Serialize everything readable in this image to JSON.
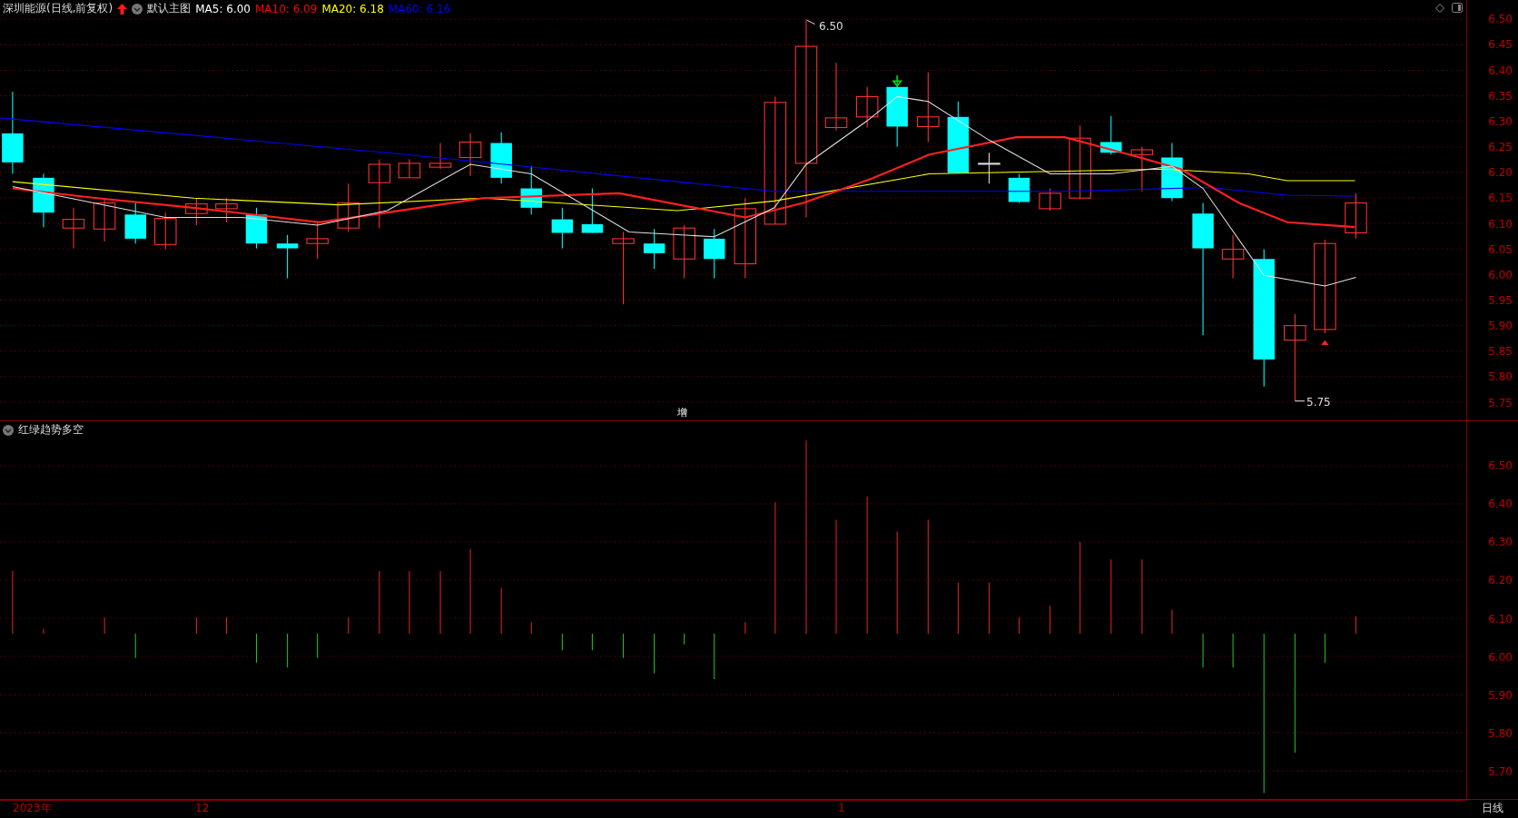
{
  "header": {
    "title": "深圳能源(日线,前复权)",
    "template": "默认主图",
    "moving_averages": [
      {
        "label": "MA5: 6.00",
        "color": "#ffffff"
      },
      {
        "label": "MA10: 6.09",
        "color": "#ff0000"
      },
      {
        "label": "MA20: 6.18",
        "color": "#ffff00"
      },
      {
        "label": "MA60: 6.16",
        "color": "#0000ff"
      }
    ]
  },
  "price_axis": {
    "ticks": [
      "6.50",
      "6.45",
      "6.40",
      "6.35",
      "6.30",
      "6.25",
      "6.20",
      "6.15",
      "6.10",
      "6.05",
      "6.00",
      "5.95",
      "5.90",
      "5.85",
      "5.80",
      "5.75"
    ]
  },
  "annotations": {
    "high": "6.50",
    "low": "5.75"
  },
  "divider_marker": "增",
  "indicator": {
    "name": "红绿趋势多空",
    "ticks": [
      "6.50",
      "6.40",
      "6.30",
      "6.20",
      "6.10",
      "6.00",
      "5.90",
      "5.80",
      "5.70"
    ]
  },
  "time_axis": {
    "labels": [
      "2023年",
      "12",
      "1"
    ],
    "period": "日线"
  }
}
